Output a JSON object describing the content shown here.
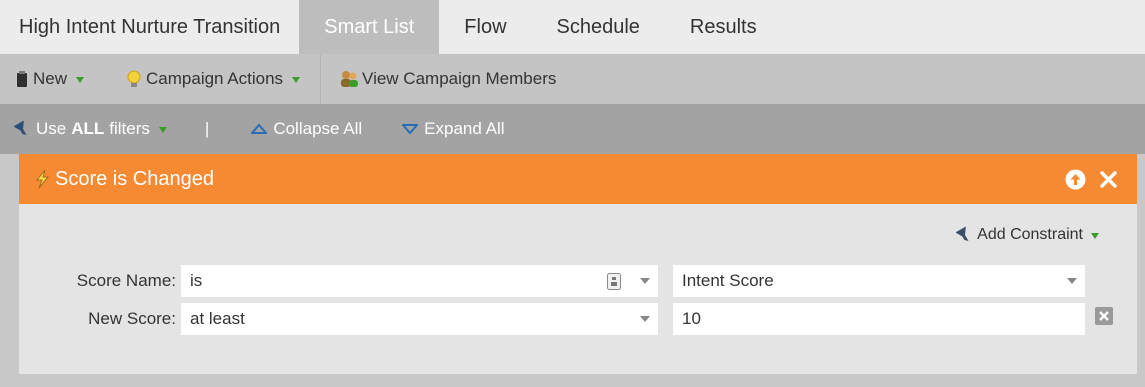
{
  "tabs": {
    "program_name": "High Intent Nurture Transition",
    "smart_list": "Smart List",
    "flow": "Flow",
    "schedule": "Schedule",
    "results": "Results"
  },
  "toolbar": {
    "new_label": "New",
    "campaign_actions_label": "Campaign Actions",
    "view_members_label": "View Campaign Members"
  },
  "filterbar": {
    "use_prefix": "Use",
    "use_bold": "ALL",
    "use_suffix": "filters",
    "separator": "|",
    "collapse_all": "Collapse All",
    "expand_all": "Expand All"
  },
  "filter": {
    "title": "Score is Changed",
    "add_constraint": "Add Constraint",
    "rows": [
      {
        "label": "Score Name:",
        "operator": "is",
        "value": "Intent Score"
      },
      {
        "label": "New Score:",
        "operator": "at least",
        "value": "10"
      }
    ]
  },
  "colors": {
    "accent_orange": "#f58a32",
    "caret_green": "#3b9c2a",
    "arrow_blue": "#2a6db5"
  }
}
